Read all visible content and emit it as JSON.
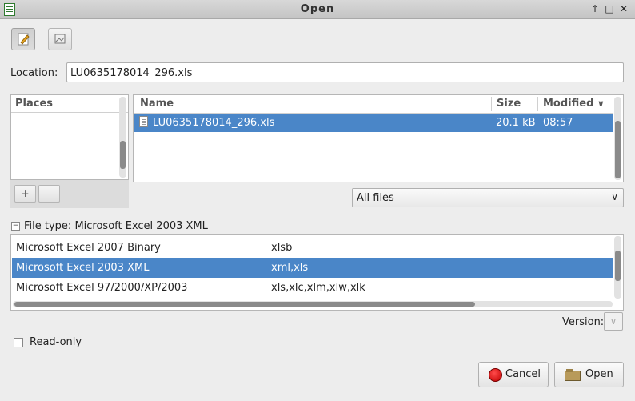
{
  "window": {
    "title": "Open"
  },
  "location": {
    "label": "Location:",
    "value": "LU0635178014_296.xls"
  },
  "places": {
    "header": "Places"
  },
  "files": {
    "headers": {
      "name": "Name",
      "size": "Size",
      "modified": "Modified"
    },
    "rows": [
      {
        "name": "LU0635178014_296.xls",
        "size": "20.1 kB",
        "modified": "08:57"
      }
    ]
  },
  "filter": {
    "value": "All files"
  },
  "file_type": {
    "label": "File type: Microsoft Excel 2003 XML",
    "rows": [
      {
        "name": "Microsoft Excel 2007 Binary",
        "ext": "xlsb"
      },
      {
        "name": "Microsoft Excel 2003 XML",
        "ext": "xml,xls"
      },
      {
        "name": "Microsoft Excel 97/2000/XP/2003",
        "ext": "xls,xlc,xlm,xlw,xlk"
      }
    ]
  },
  "version": {
    "label": "Version:"
  },
  "read_only": {
    "label": "Read-only",
    "checked": false
  },
  "buttons": {
    "cancel": "Cancel",
    "open": "Open"
  },
  "colors": {
    "selection": "#4a86c8",
    "cancel_icon": "#d40000"
  }
}
